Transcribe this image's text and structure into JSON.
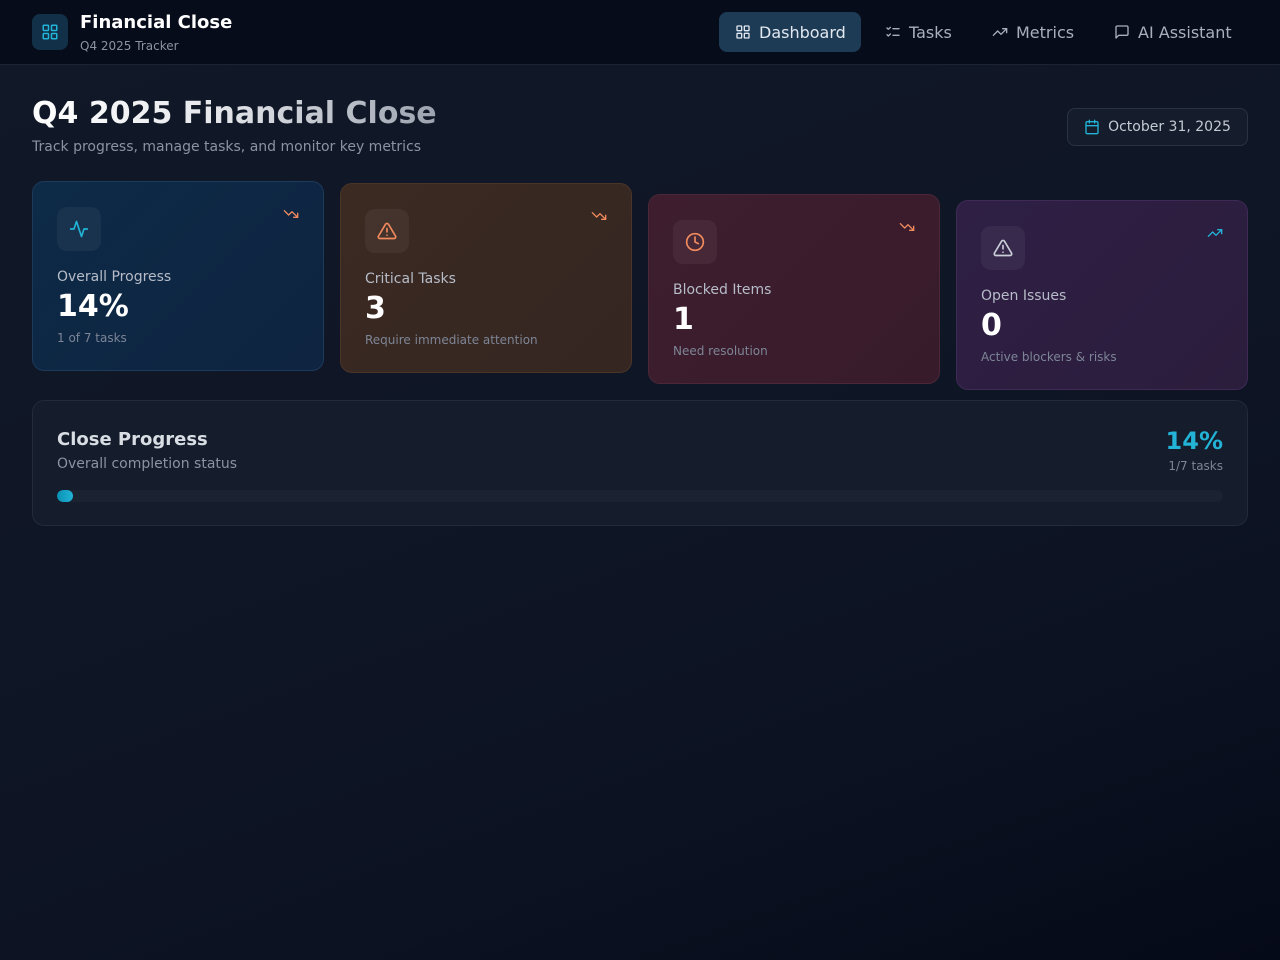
{
  "app": {
    "title": "Financial Close",
    "subtitle": "Q4 2025 Tracker",
    "logo_icon": "layout-grid-icon"
  },
  "nav": {
    "items": [
      {
        "label": "Dashboard",
        "icon": "layout-grid-icon",
        "active": true
      },
      {
        "label": "Tasks",
        "icon": "list-checks-icon",
        "active": false
      },
      {
        "label": "Metrics",
        "icon": "trending-up-icon",
        "active": false
      },
      {
        "label": "AI Assistant",
        "icon": "message-square-icon",
        "active": false
      }
    ]
  },
  "page": {
    "title": "Q4 2025 Financial Close",
    "subtitle": "Track progress, manage tasks, and monitor key metrics",
    "date": "October 31, 2025",
    "date_icon": "calendar-icon"
  },
  "stats": [
    {
      "label": "Overall Progress",
      "value": "14%",
      "note": "1 of 7 tasks",
      "icon": "activity-icon",
      "trend": "trending-down-icon",
      "accent": "#22b3d6",
      "trend_color": "#f08a5d"
    },
    {
      "label": "Critical Tasks",
      "value": "3",
      "note": "Require immediate attention",
      "icon": "alert-triangle-icon",
      "trend": "trending-down-icon",
      "accent": "#f08a5d",
      "trend_color": "#f08a5d"
    },
    {
      "label": "Blocked Items",
      "value": "1",
      "note": "Need resolution",
      "icon": "clock-icon",
      "trend": "trending-down-icon",
      "accent": "#f08a5d",
      "trend_color": "#f08a5d"
    },
    {
      "label": "Open Issues",
      "value": "0",
      "note": "Active blockers & risks",
      "icon": "alert-triangle-icon",
      "trend": "trending-up-icon",
      "accent": "#c9ced8",
      "trend_color": "#22b3d6"
    }
  ],
  "progress": {
    "title": "Close Progress",
    "subtitle": "Overall completion status",
    "percent_label": "14%",
    "count_label": "1/7 tasks",
    "fraction": 0.014,
    "accent": "#22b3d6"
  }
}
